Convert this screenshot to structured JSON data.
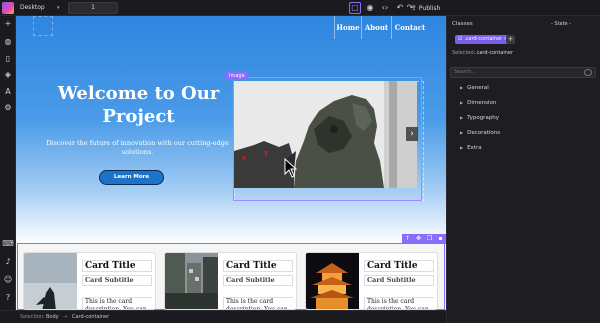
{
  "topbar": {
    "device": "Desktop",
    "width_value": "1",
    "publish_label": "Publish",
    "icons": [
      "square-outline-icon",
      "eye-icon",
      "code-icon",
      "undo-icon",
      "redo-icon",
      "download-icon",
      "publish-icon",
      "brush-icon",
      "gear-icon",
      "back-arrow-icon"
    ]
  },
  "leftbar": {
    "icons": [
      "plus-icon",
      "paint-palette-icon",
      "page-icon",
      "layers-icon",
      "typography-icon",
      "components-icon",
      "keyboard-icon",
      "bell-icon",
      "user-icon",
      "help-icon"
    ]
  },
  "canvas": {
    "nav": [
      "Home",
      "About",
      "Contact"
    ],
    "hero_title": "Welcome to Our Project",
    "hero_subtitle": "Discover the future of innovation with our cutting-edge solutions.",
    "cta_label": "Learn More",
    "image_tag": "Image",
    "slider_next": "›",
    "cards": [
      {
        "title": "Card Title",
        "subtitle": "Card Subtitle",
        "description": "This is the card description. You can add"
      },
      {
        "title": "Card Title",
        "subtitle": "Card Subtitle",
        "description": "This is the card description. You can add"
      },
      {
        "title": "Card Title",
        "subtitle": "Card Subtitle",
        "description": "This is the card description. You can add"
      }
    ]
  },
  "statusbar": {
    "selection_label": "Selection:",
    "crumb_1": "Body",
    "separator": "→",
    "crumb_2": "Card-container"
  },
  "rightpanel": {
    "classes_label": "Classes",
    "state_label": "- State -",
    "class_chip": "☑ .card-container ×",
    "add_label": "+",
    "selected_label": "Selected:",
    "selected_value": ".card-container",
    "search_placeholder": "Search...",
    "sectors": [
      "General",
      "Dimension",
      "Typography",
      "Decorations",
      "Extra"
    ]
  },
  "colors": {
    "accent": "#8a6cff",
    "hero_blue": "#2f86e0",
    "button_blue": "#1d73c9",
    "editor_bg": "#1e1e22"
  }
}
